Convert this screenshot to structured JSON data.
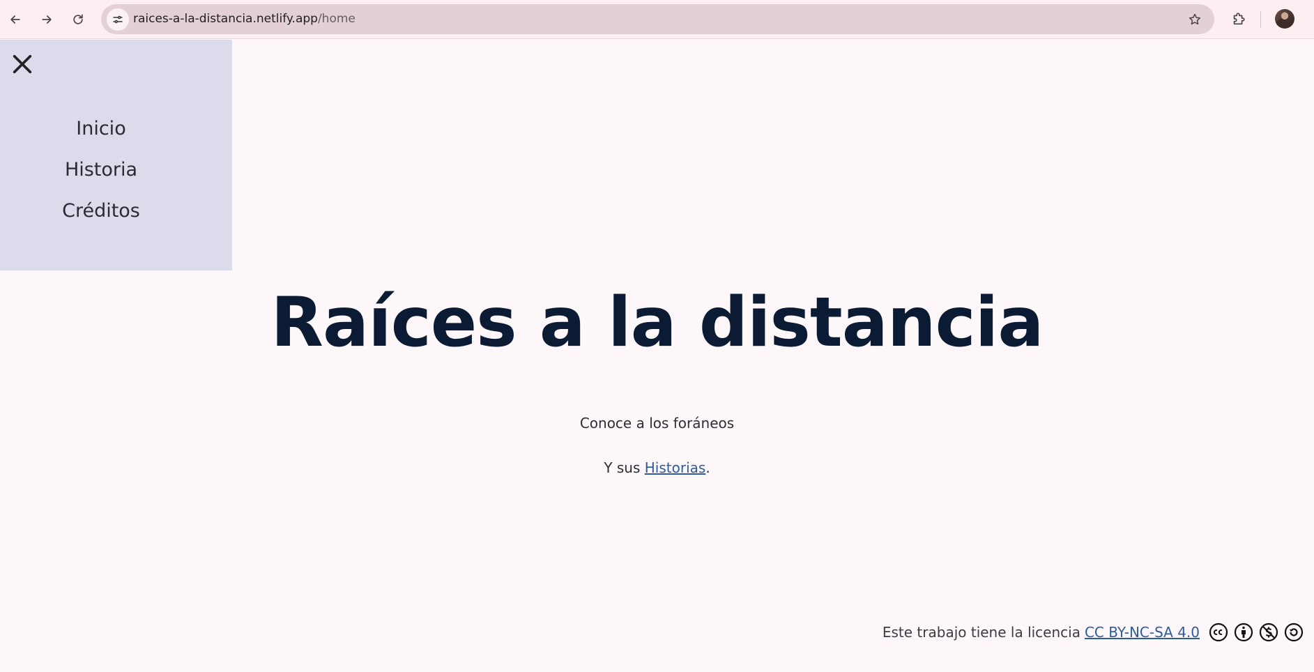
{
  "browser": {
    "url_host": "raices-a-la-distancia.netlify.app",
    "url_path": "/home",
    "icons": {
      "back": "back-arrow-icon",
      "forward": "forward-arrow-icon",
      "reload": "reload-icon",
      "site_info": "tune-icon",
      "bookmark": "star-icon",
      "extensions": "puzzle-icon"
    }
  },
  "menu": {
    "close_icon": "close-icon",
    "items": [
      {
        "label": "Inicio"
      },
      {
        "label": "Historia"
      },
      {
        "label": "Créditos"
      }
    ]
  },
  "hero": {
    "title": "Raíces a la distancia"
  },
  "intro": {
    "line1": "Conoce a los foráneos",
    "line2_prefix": "Y sus ",
    "line2_link": "Historias",
    "line2_suffix": "."
  },
  "footer": {
    "text": "Este trabajo tiene la licencia",
    "license_link": "CC BY-NC-SA 4.0",
    "license_icons": [
      "cc-icon",
      "by-icon",
      "nc-icon",
      "sa-icon"
    ]
  },
  "colors": {
    "menu_bg": "#dcdbeb",
    "page_bg": "#fdf7fa",
    "title": "#0b1b33",
    "link": "#2d5c9a",
    "browser_bar": "#fdeef2"
  }
}
